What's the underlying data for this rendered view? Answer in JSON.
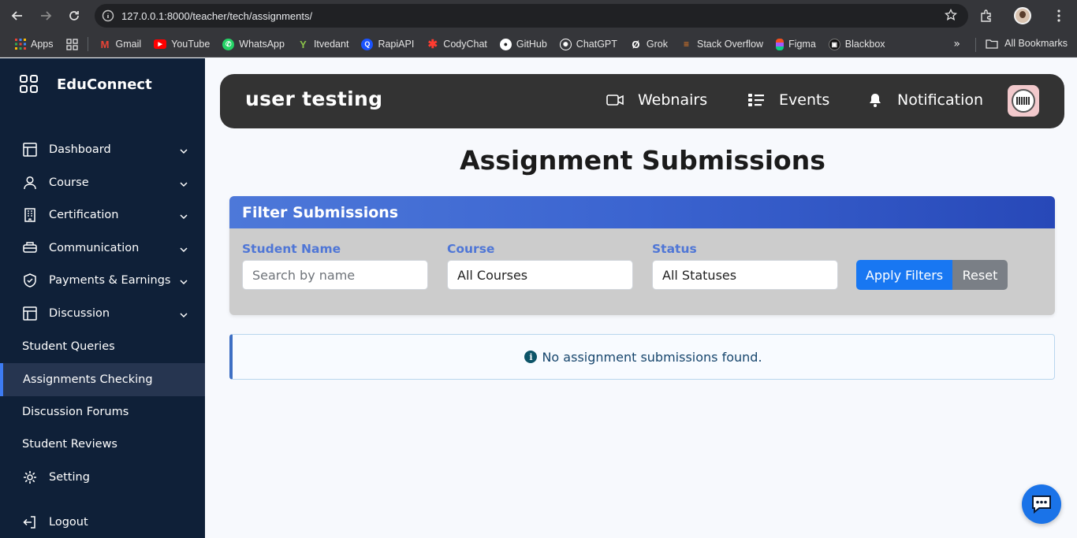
{
  "browser": {
    "url": "127.0.0.1:8000/teacher/tech/assignments/",
    "bookmarks": [
      {
        "label": "Apps",
        "color": "#ea4335"
      },
      {
        "label": "Gmail",
        "color": "#d93025"
      },
      {
        "label": "YouTube",
        "color": "#ff0000"
      },
      {
        "label": "WhatsApp",
        "color": "#25d366"
      },
      {
        "label": "Itvedant",
        "color": "#7cb342"
      },
      {
        "label": "RapiAPI",
        "color": "#1a53ff"
      },
      {
        "label": "CodyChat",
        "color": "#ff3b30"
      },
      {
        "label": "GitHub",
        "color": "#ffffff"
      },
      {
        "label": "ChatGPT",
        "color": "#ffffff"
      },
      {
        "label": "Grok",
        "color": "#ffffff"
      },
      {
        "label": "Stack Overflow",
        "color": "#f48024"
      },
      {
        "label": "Figma",
        "color": "#a259ff"
      },
      {
        "label": "Blackbox",
        "color": "#111111"
      }
    ],
    "all_bookmarks": "All Bookmarks"
  },
  "sidebar": {
    "brand": "EduConnect",
    "items": [
      {
        "label": "Dashboard",
        "icon": "table-icon",
        "has_chevron": true
      },
      {
        "label": "Course",
        "icon": "user-icon",
        "has_chevron": true
      },
      {
        "label": "Certification",
        "icon": "building-icon",
        "has_chevron": true
      },
      {
        "label": "Communication",
        "icon": "bus-icon",
        "has_chevron": true
      },
      {
        "label": "Payments & Earnings",
        "icon": "shield-icon",
        "has_chevron": true
      },
      {
        "label": "Discussion",
        "icon": "table-icon",
        "has_chevron": true
      },
      {
        "label": "Student Queries",
        "icon": "",
        "has_chevron": false
      },
      {
        "label": "Assignments Checking",
        "icon": "",
        "has_chevron": false,
        "active": true
      },
      {
        "label": "Discussion Forums",
        "icon": "",
        "has_chevron": false
      },
      {
        "label": "Student Reviews",
        "icon": "",
        "has_chevron": false
      },
      {
        "label": "Setting",
        "icon": "gear-icon",
        "has_chevron": false
      },
      {
        "label": "Logout",
        "icon": "logout-icon",
        "has_chevron": false
      }
    ]
  },
  "topbar": {
    "title": "user testing",
    "webinars": "Webnairs",
    "events": "Events",
    "notification": "Notification"
  },
  "page": {
    "title": "Assignment Submissions"
  },
  "filters": {
    "heading": "Filter Submissions",
    "student_label": "Student Name",
    "student_placeholder": "Search by name",
    "course_label": "Course",
    "course_value": "All Courses",
    "status_label": "Status",
    "status_value": "All Statuses",
    "apply": "Apply Filters",
    "reset": "Reset"
  },
  "alert": {
    "message": "No assignment submissions found."
  },
  "colors": {
    "sidebar_bg": "#0f2038",
    "accent": "#1877f2",
    "topbar_bg": "#333333",
    "filter_header": "#3b64d0"
  }
}
